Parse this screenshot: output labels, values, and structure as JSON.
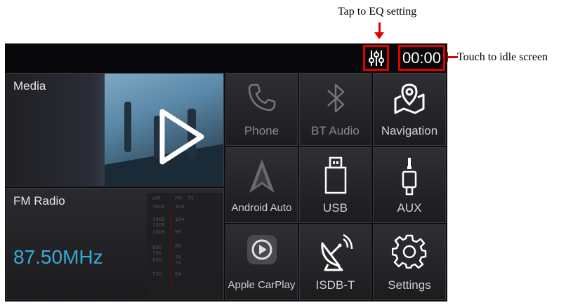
{
  "annotations": {
    "eq_note": "Tap to EQ setting",
    "idle_note": "Touch to idle screen"
  },
  "statusbar": {
    "clock": "00:00"
  },
  "media": {
    "title": "Media"
  },
  "radio": {
    "title": "FM Radio",
    "frequency": "87.50MHz",
    "dial": {
      "bands": [
        "AM",
        "FM",
        "TV"
      ],
      "am_ticks": [
        "1600",
        "1400",
        "1200",
        "1000",
        "800",
        "700",
        "600",
        "530"
      ],
      "fm_ticks": [
        "108",
        "104",
        "98",
        "88",
        "76",
        "74",
        "64"
      ]
    }
  },
  "apps": [
    {
      "label": "Phone",
      "icon": "phone-icon",
      "enabled": false
    },
    {
      "label": "BT Audio",
      "icon": "bluetooth-icon",
      "enabled": false
    },
    {
      "label": "Navigation",
      "icon": "map-pin-icon",
      "enabled": true
    },
    {
      "label": "Android Auto",
      "icon": "android-auto-icon",
      "enabled": true
    },
    {
      "label": "USB",
      "icon": "usb-icon",
      "enabled": true
    },
    {
      "label": "AUX",
      "icon": "aux-jack-icon",
      "enabled": true
    },
    {
      "label": "Apple CarPlay",
      "icon": "carplay-icon",
      "enabled": true
    },
    {
      "label": "ISDB-T",
      "icon": "satellite-dish-icon",
      "enabled": true
    },
    {
      "label": "Settings",
      "icon": "gear-icon",
      "enabled": true
    }
  ],
  "colors": {
    "annotation_red": "#e00000",
    "frequency_blue": "#3aa9d6",
    "background": "#0c0c0e"
  }
}
